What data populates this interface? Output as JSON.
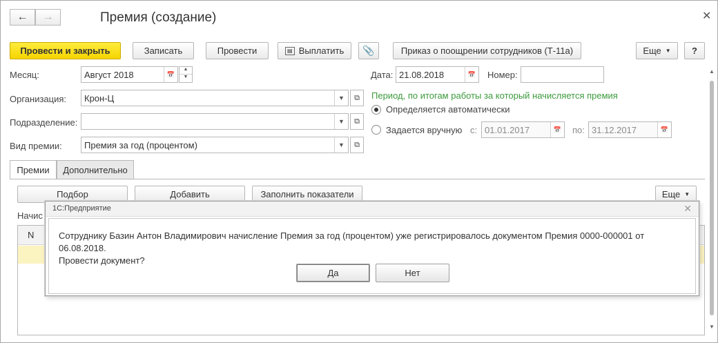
{
  "window": {
    "title": "Премия (создание)"
  },
  "toolbar": {
    "post_close": "Провести и закрыть",
    "save": "Записать",
    "post": "Провести",
    "pay": "Выплатить",
    "order": "Приказ о поощрении сотрудников (Т-11а)",
    "more": "Еще",
    "help": "?"
  },
  "form": {
    "month_label": "Месяц:",
    "month_value": "Август 2018",
    "date_label": "Дата:",
    "date_value": "21.08.2018",
    "number_label": "Номер:",
    "number_value": "",
    "org_label": "Организация:",
    "org_value": "Крон-Ц",
    "dept_label": "Подразделение:",
    "dept_value": "",
    "bonus_type_label": "Вид премии:",
    "bonus_type_value": "Премия за год (процентом)",
    "period_heading": "Период, по итогам работы за который начисляется премия",
    "radio_auto": "Определяется автоматически",
    "radio_manual": "Задается вручную",
    "from_label": "с:",
    "from_value": "01.01.2017",
    "to_label": "по:",
    "to_value": "31.12.2017"
  },
  "tabs": [
    {
      "label": "Премии",
      "active": true
    },
    {
      "label": "Дополнительно",
      "active": false
    }
  ],
  "table_toolbar": {
    "select": "Подбор",
    "add": "Добавить",
    "fill": "Заполнить показатели",
    "more": "Еще"
  },
  "table": {
    "caption": "Начис",
    "col_n": "N"
  },
  "dialog": {
    "title": "1С:Предприятие",
    "line1": "Сотруднику Базин Антон Владимирович начисление Премия за год (процентом) уже регистрировалось документом Премия 0000-000001 от 06.08.2018.",
    "line2": "Провести документ?",
    "yes": "Да",
    "no": "Нет"
  },
  "colors": {
    "primary_button": "#f5d400",
    "period_heading": "#3c9a3c"
  }
}
